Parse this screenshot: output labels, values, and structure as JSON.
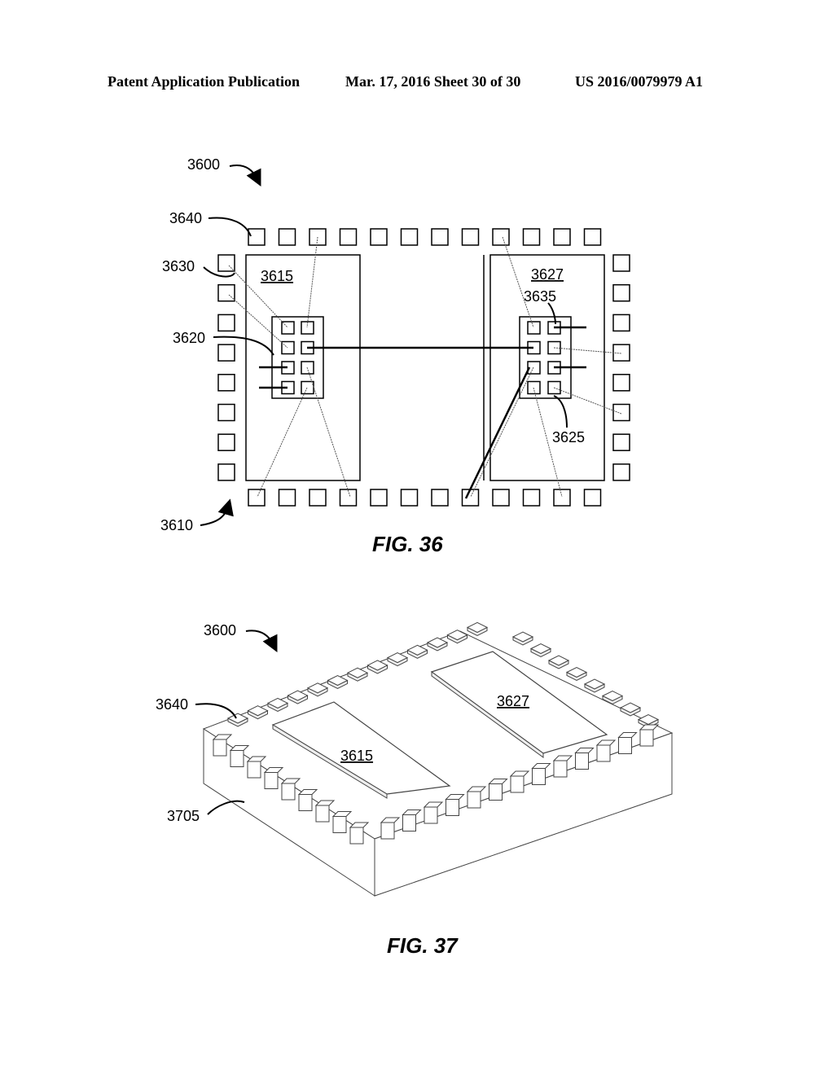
{
  "header": {
    "publication": "Patent Application Publication",
    "date_sheet": "Mar. 17, 2016  Sheet 30 of 30",
    "number": "US 2016/0079979 A1"
  },
  "fig36": {
    "caption": "FIG. 36",
    "labels": {
      "device": "3600",
      "pads": "3640",
      "side_pad": "3630",
      "left_array": "3620",
      "left_die": "3615",
      "right_die": "3627",
      "right_pad": "3635",
      "right_array": "3625",
      "substrate": "3610"
    }
  },
  "fig37": {
    "caption": "FIG. 37",
    "labels": {
      "device": "3600",
      "pads": "3640",
      "left_die": "3615",
      "right_die": "3627",
      "package_body": "3705"
    }
  }
}
